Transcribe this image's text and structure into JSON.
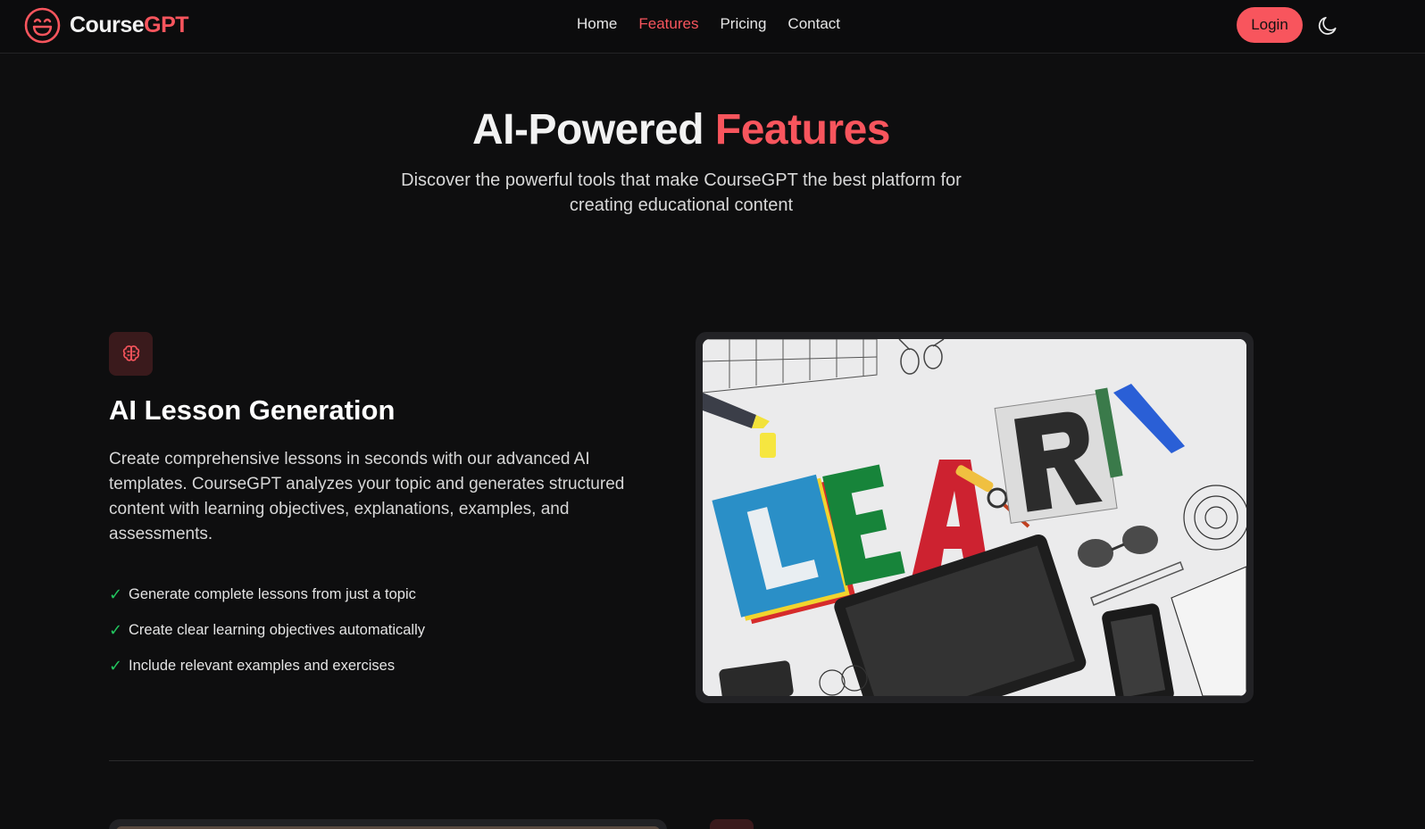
{
  "brand": {
    "name_part1": "Course",
    "name_part2": "GPT",
    "accent": "#f8555d"
  },
  "nav": {
    "items": [
      {
        "label": "Home"
      },
      {
        "label": "Features"
      },
      {
        "label": "Pricing"
      },
      {
        "label": "Contact"
      }
    ],
    "active": "Features"
  },
  "header": {
    "login_label": "Login",
    "theme_icon": "moon-icon"
  },
  "hero": {
    "title_part1": "AI-Powered ",
    "title_part2": "Features",
    "subtitle": "Discover the powerful tools that make CourseGPT the best platform for creating educational content"
  },
  "feature": {
    "icon": "brain-icon",
    "title": "AI Lesson Generation",
    "description": "Create comprehensive lessons in seconds with our advanced AI templates. CourseGPT analyzes your topic and generates structured content with learning objectives, explanations, examples, and assessments.",
    "bullets": [
      "Generate complete lessons from just a topic",
      "Create clear learning objectives automatically",
      "Include relevant examples and exercises"
    ],
    "image_text": "LEARN"
  },
  "colors": {
    "check": "#22c55e",
    "background": "#0e0e0f"
  }
}
